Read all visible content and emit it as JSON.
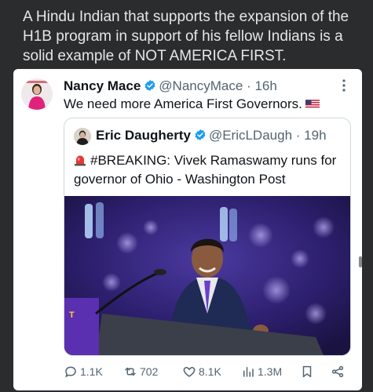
{
  "caption": "A Hindu Indian that supports the expansion of the H1B program in support of his fellow Indians is a solid example of NOT AMERICA FIRST.",
  "tweet": {
    "author_name": "Nancy Mace",
    "handle": "@NancyMace",
    "separator": "·",
    "time": "16h",
    "text": "We need more America First Governors.",
    "flag_icon": "us-flag-icon"
  },
  "quoted_tweet": {
    "author_name": "Eric Daugherty",
    "handle": "@EricLDaugh",
    "separator": "·",
    "time": "19h",
    "text": "#BREAKING: Vivek Ramaswamy runs for governor of Ohio - Washington Post",
    "siren_icon": "siren-icon"
  },
  "actions": {
    "replies": "1.1K",
    "reposts": "702",
    "likes": "8.1K",
    "views": "1.3M"
  },
  "colors": {
    "background": "#2b2c2e",
    "verified": "#1d9bf0",
    "muted": "#536471"
  }
}
